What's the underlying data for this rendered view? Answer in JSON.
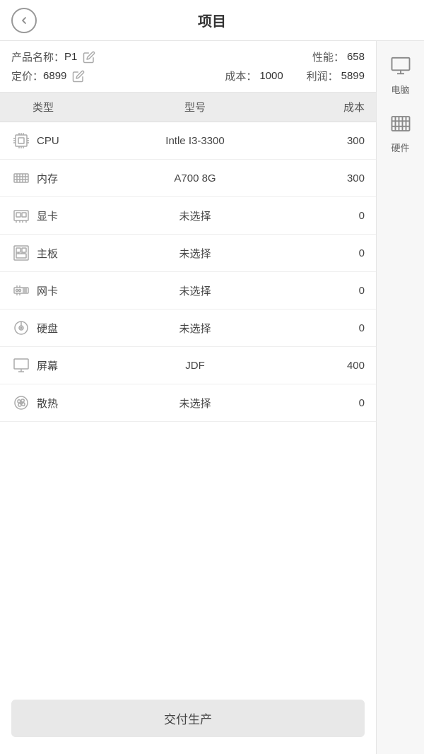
{
  "header": {
    "title": "项目",
    "back_label": "返回"
  },
  "product": {
    "name_label": "产品名称：",
    "name_value": "P1",
    "price_label": "定价：",
    "price_value": "6899",
    "performance_label": "性能：",
    "performance_value": "658",
    "cost_label": "成本：",
    "cost_value": "1000",
    "profit_label": "利润：",
    "profit_value": "5899"
  },
  "table": {
    "headers": [
      "类型",
      "型号",
      "成本"
    ],
    "rows": [
      {
        "icon": "cpu",
        "type": "CPU",
        "model": "Intle I3-3300",
        "cost": "300"
      },
      {
        "icon": "memory",
        "type": "内存",
        "model": "A700 8G",
        "cost": "300"
      },
      {
        "icon": "gpu",
        "type": "显卡",
        "model": "未选择",
        "cost": "0"
      },
      {
        "icon": "motherboard",
        "type": "主板",
        "model": "未选择",
        "cost": "0"
      },
      {
        "icon": "network",
        "type": "网卡",
        "model": "未选择",
        "cost": "0"
      },
      {
        "icon": "hdd",
        "type": "硬盘",
        "model": "未选择",
        "cost": "0"
      },
      {
        "icon": "monitor",
        "type": "屏幕",
        "model": "JDF",
        "cost": "400"
      },
      {
        "icon": "fan",
        "type": "散热",
        "model": "未选择",
        "cost": "0"
      }
    ]
  },
  "sidebar": {
    "items": [
      {
        "label": "电脑",
        "icon": "computer"
      },
      {
        "label": "硬件",
        "icon": "hardware"
      }
    ]
  },
  "submit": {
    "label": "交付生产"
  }
}
